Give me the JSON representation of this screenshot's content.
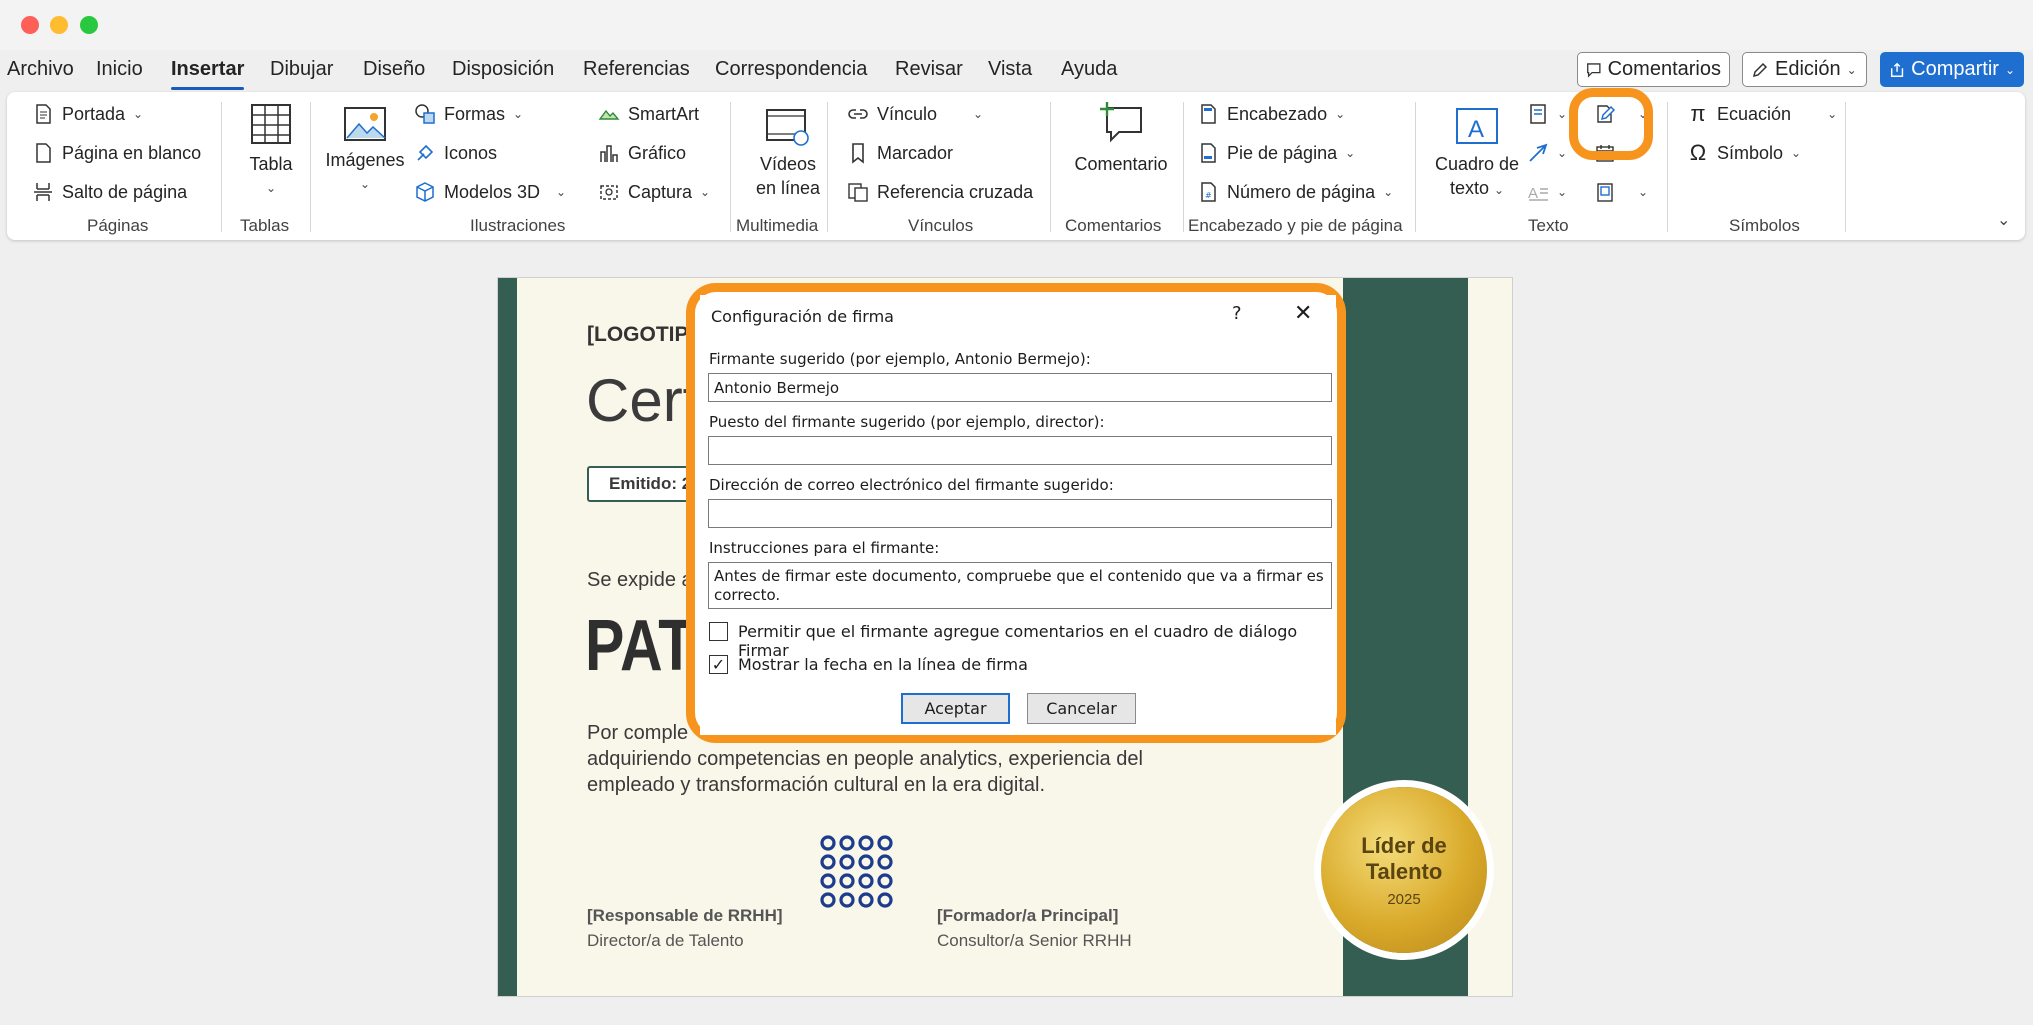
{
  "menu": {
    "tabs": [
      "Archivo",
      "Inicio",
      "Insertar",
      "Dibujar",
      "Diseño",
      "Disposición",
      "Referencias",
      "Correspondencia",
      "Revisar",
      "Vista",
      "Ayuda"
    ],
    "active_tab": "Insertar",
    "comments_label": "Comentarios",
    "editing_label": "Edición",
    "share_label": "Compartir"
  },
  "ribbon": {
    "paginas": {
      "portada": "Portada",
      "blank": "Página en blanco",
      "break": "Salto de página",
      "group": "Páginas"
    },
    "tablas": {
      "tabla": "Tabla",
      "group": "Tablas"
    },
    "ilustraciones": {
      "imagenes": "Imágenes",
      "formas": "Formas",
      "iconos": "Iconos",
      "modelos": "Modelos 3D",
      "smartart": "SmartArt",
      "grafico": "Gráfico",
      "captura": "Captura",
      "group": "Ilustraciones"
    },
    "multimedia": {
      "videos_1": "Vídeos",
      "videos_2": "en línea",
      "group": "Multimedia"
    },
    "vinculos": {
      "vinculo": "Vínculo",
      "marcador": "Marcador",
      "referencia": "Referencia cruzada",
      "group": "Vínculos"
    },
    "comentarios": {
      "comentario": "Comentario",
      "group": "Comentarios"
    },
    "encabezado": {
      "encabezado": "Encabezado",
      "pie": "Pie de página",
      "numero": "Número de página",
      "group": "Encabezado y pie de página"
    },
    "texto": {
      "cuadro_1": "Cuadro de",
      "cuadro_2": "texto",
      "group": "Texto"
    },
    "simbolos": {
      "ecuacion": "Ecuación",
      "simbolo": "Símbolo",
      "group": "Símbolos"
    }
  },
  "document": {
    "logo": "[LOGOTIPO",
    "title": "Cert",
    "issued": "Emitido: 2",
    "intro": "Se expide a",
    "name": "PAT",
    "body_1": "Por comple",
    "body_2": "adquiriendo competencias en people analytics, experiencia del",
    "body_3": "empleado y transformación cultural en la era digital.",
    "sig1_title": "[Responsable de RRHH]",
    "sig1_role": "Director/a de Talento",
    "sig2_title": "[Formador/a Principal]",
    "sig2_role": "Consultor/a Senior RRHH",
    "medal_line1": "Líder de",
    "medal_line2": "Talento",
    "medal_year": "2025"
  },
  "dialog": {
    "title": "Configuración de firma",
    "help": "?",
    "signer_label": "Firmante sugerido (por ejemplo, Antonio Bermejo):",
    "signer_value": "Antonio Bermejo",
    "position_label": "Puesto del firmante sugerido (por ejemplo, director):",
    "position_value": "",
    "email_label": "Dirección de correo electrónico del firmante sugerido:",
    "email_value": "",
    "instructions_label": "Instrucciones para el firmante:",
    "instructions_value": "Antes de firmar este documento, compruebe que el contenido que va a firmar es correcto.",
    "allow_comments_label": "Permitir que el firmante agregue comentarios en el cuadro de diálogo Firmar",
    "allow_comments_checked": false,
    "show_date_label": "Mostrar la fecha en la línea de firma",
    "show_date_checked": true,
    "ok_label": "Aceptar",
    "cancel_label": "Cancelar"
  },
  "colors": {
    "accent": "#f7941d",
    "word_blue": "#1f6fd1",
    "doc_green": "#355e52"
  }
}
